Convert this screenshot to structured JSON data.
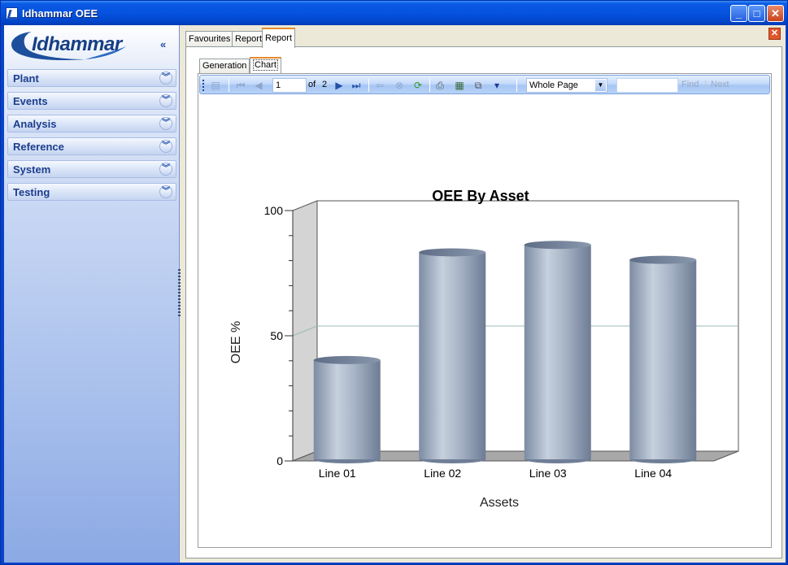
{
  "window": {
    "title": "Idhammar OEE",
    "controls": [
      "_",
      "□",
      "✕"
    ]
  },
  "sidebar": {
    "logo": "Idhammar",
    "collapse": "«",
    "items": [
      {
        "label": "Plant"
      },
      {
        "label": "Events"
      },
      {
        "label": "Analysis"
      },
      {
        "label": "Reference"
      },
      {
        "label": "System"
      },
      {
        "label": "Testing"
      }
    ],
    "expand_glyph": "»"
  },
  "tabs": [
    "Favourites",
    "Report",
    "Report"
  ],
  "active_tab": 2,
  "inner_tabs": [
    "Generation",
    "Chart"
  ],
  "active_inner_tab": 1,
  "toolbar": {
    "page_input": "1",
    "of_label": "of",
    "total_pages": "2",
    "zoom": "Whole Page",
    "find_label": "Find",
    "next_label": "Next"
  },
  "chart_data": {
    "type": "bar",
    "title": "OEE By Asset",
    "xlabel": "Assets",
    "ylabel": "OEE %",
    "categories": [
      "Line 01",
      "Line 02",
      "Line 03",
      "Line 04"
    ],
    "values": [
      39,
      82,
      85,
      79
    ],
    "ylim": [
      0,
      100
    ],
    "yticks": [
      0,
      50,
      100
    ],
    "grid": true,
    "style": "3d-cylinder",
    "bar_color": "#9aa8bc"
  }
}
